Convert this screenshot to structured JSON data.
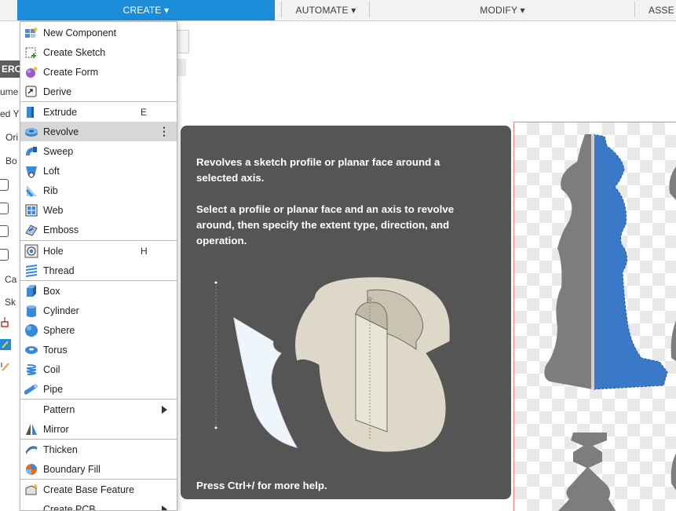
{
  "toolbar": {
    "create": "CREATE ▾",
    "automate": "AUTOMATE ▾",
    "modify": "MODIFY ▾",
    "assemble": "ASSE"
  },
  "browser": {
    "labels": [
      "ERO",
      "ume",
      "ed Y",
      "Ori",
      "Bo",
      "Ca",
      "Sk"
    ]
  },
  "menu": {
    "items": [
      {
        "label": "New Component",
        "icon": "new-component-icon"
      },
      {
        "label": "Create Sketch",
        "icon": "create-sketch-icon"
      },
      {
        "label": "Create Form",
        "icon": "create-form-icon"
      },
      {
        "label": "Derive",
        "icon": "derive-icon"
      },
      {
        "label": "Extrude",
        "icon": "extrude-icon",
        "shortcut": "E"
      },
      {
        "label": "Revolve",
        "icon": "revolve-icon",
        "more": "⋮"
      },
      {
        "label": "Sweep",
        "icon": "sweep-icon"
      },
      {
        "label": "Loft",
        "icon": "loft-icon"
      },
      {
        "label": "Rib",
        "icon": "rib-icon"
      },
      {
        "label": "Web",
        "icon": "web-icon"
      },
      {
        "label": "Emboss",
        "icon": "emboss-icon"
      },
      {
        "label": "Hole",
        "icon": "hole-icon",
        "shortcut": "H"
      },
      {
        "label": "Thread",
        "icon": "thread-icon"
      },
      {
        "label": "Box",
        "icon": "box-icon"
      },
      {
        "label": "Cylinder",
        "icon": "cylinder-icon"
      },
      {
        "label": "Sphere",
        "icon": "sphere-icon"
      },
      {
        "label": "Torus",
        "icon": "torus-icon"
      },
      {
        "label": "Coil",
        "icon": "coil-icon"
      },
      {
        "label": "Pipe",
        "icon": "pipe-icon"
      },
      {
        "label": "Pattern",
        "icon": "",
        "submenu": true
      },
      {
        "label": "Mirror",
        "icon": "mirror-icon"
      },
      {
        "label": "Thicken",
        "icon": "thicken-icon"
      },
      {
        "label": "Boundary Fill",
        "icon": "boundary-fill-icon"
      },
      {
        "label": "Create Base Feature",
        "icon": "base-feature-icon"
      },
      {
        "label": "Create PCB",
        "icon": "",
        "submenu": true
      }
    ]
  },
  "tooltip": {
    "line1": "Revolves a sketch profile or planar face around a",
    "line2": "selected axis.",
    "line3": "Select a profile or planar face and an axis to revolve",
    "line4": "around, then specify the extent type, direction, and",
    "line5": "operation.",
    "footer": "Press Ctrl+/ for more help."
  },
  "colors": {
    "accent": "#1a8cd8",
    "tooltip_bg": "#555555",
    "highlight": "#d7d7d7",
    "revolve_blue": "#3a78c8"
  }
}
